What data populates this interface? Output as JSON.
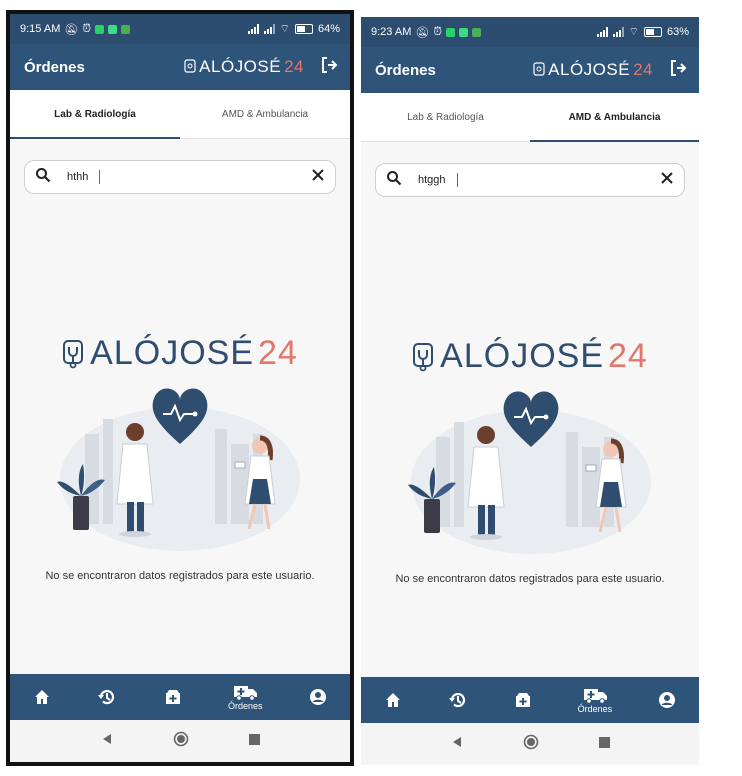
{
  "screens": [
    {
      "status": {
        "time": "9:15 AM",
        "battery": "64",
        "battery_level": 0.64
      },
      "appbar": {
        "title": "Órdenes",
        "brand": "ALÓJOSÉ",
        "brand_accent": "24"
      },
      "tabs": [
        {
          "label": "Lab & Radiología",
          "active": true
        },
        {
          "label": "AMD & Ambulancia",
          "active": false
        }
      ],
      "search": {
        "value": "hthh"
      },
      "logo": {
        "text": "ALÓJOSÉ",
        "accent": "24"
      },
      "empty_message": "No se encontraron datos registrados para este usuario.",
      "bottom_nav": [
        {
          "icon": "home-icon",
          "label": ""
        },
        {
          "icon": "history-icon",
          "label": ""
        },
        {
          "icon": "medical-plus-icon",
          "label": ""
        },
        {
          "icon": "ambulance-icon",
          "label": "Órdenes"
        },
        {
          "icon": "account-icon",
          "label": ""
        }
      ]
    },
    {
      "status": {
        "time": "9:23 AM",
        "battery": "63",
        "battery_level": 0.63
      },
      "appbar": {
        "title": "Órdenes",
        "brand": "ALÓJOSÉ",
        "brand_accent": "24"
      },
      "tabs": [
        {
          "label": "Lab & Radiología",
          "active": false
        },
        {
          "label": "AMD & Ambulancia",
          "active": true
        }
      ],
      "search": {
        "value": "htggh"
      },
      "logo": {
        "text": "ALÓJOSÉ",
        "accent": "24"
      },
      "empty_message": "No se encontraron datos registrados para este usuario.",
      "bottom_nav": [
        {
          "icon": "home-icon",
          "label": ""
        },
        {
          "icon": "history-icon",
          "label": ""
        },
        {
          "icon": "medical-plus-icon",
          "label": ""
        },
        {
          "icon": "ambulance-icon",
          "label": "Órdenes"
        },
        {
          "icon": "account-icon",
          "label": ""
        }
      ]
    }
  ],
  "colors": {
    "appbar": "#2f5479",
    "statusbar": "#2c4d70",
    "accent": "#e0776a",
    "brand_blue": "#2f4d6e"
  }
}
